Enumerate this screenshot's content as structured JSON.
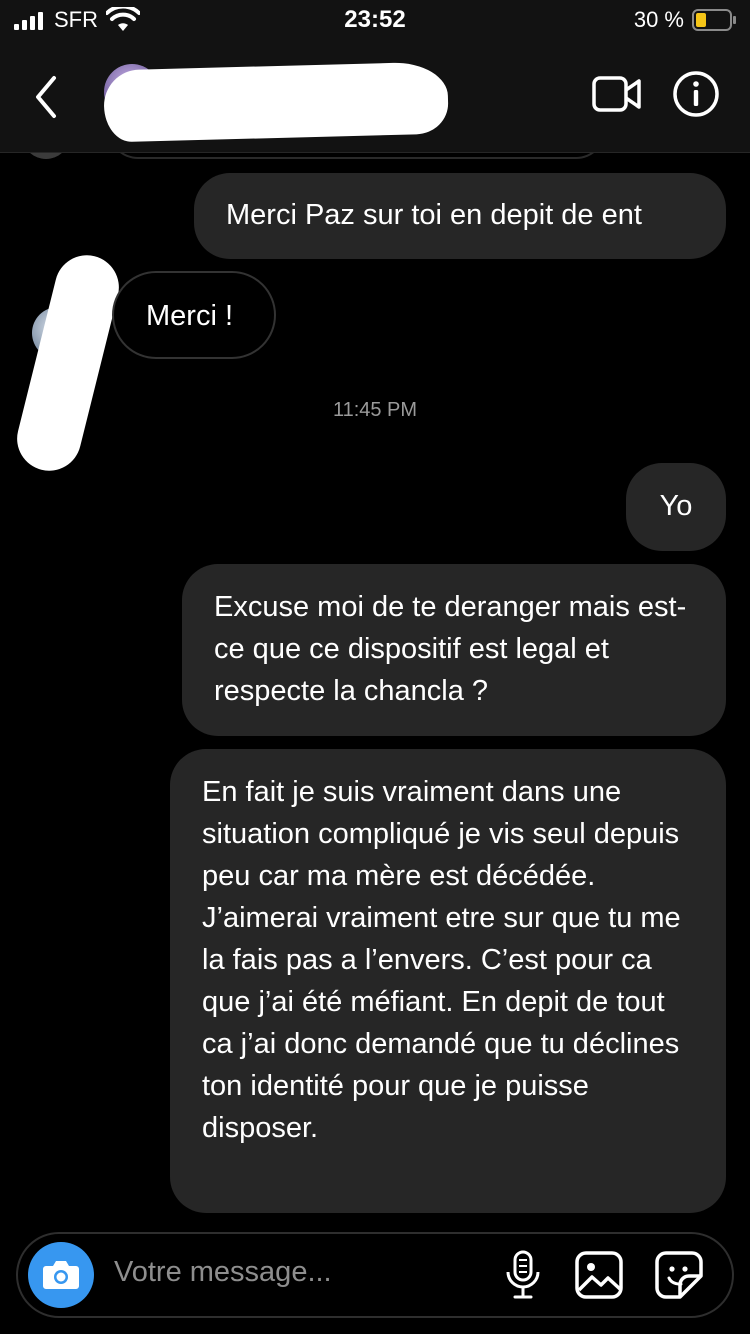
{
  "status_bar": {
    "carrier": "SFR",
    "time": "23:52",
    "battery_percent": "30 %",
    "battery_level": 0.3
  },
  "header": {
    "contact_name_redacted": true
  },
  "messages": [
    {
      "direction": "outgoing",
      "text": "Merci Paz sur toi en depit de ent"
    },
    {
      "direction": "incoming",
      "text": "Merci !"
    },
    {
      "type": "timestamp",
      "text": "11:45 PM"
    },
    {
      "direction": "outgoing",
      "text": "Yo"
    },
    {
      "direction": "outgoing",
      "text": "Excuse moi de te deranger mais est-ce que ce dispositif est legal et respecte la chancla ?"
    },
    {
      "direction": "outgoing",
      "text": "En fait je suis vraiment dans une situation compliqué je vis seul depuis peu car ma mère est décédée. J’aimerai vraiment etre sur que tu me la fais pas a l’envers. C’est pour ca que j’ai été méfiant. En depit de tout ca j’ai donc demandé que tu déclines ton identité pour que je puisse disposer."
    }
  ],
  "composer": {
    "placeholder": "Votre message...",
    "accent_color": "#3797f0"
  },
  "icons": [
    "back-icon",
    "video-call-icon",
    "info-icon",
    "camera-icon",
    "microphone-icon",
    "gallery-icon",
    "sticker-icon"
  ]
}
